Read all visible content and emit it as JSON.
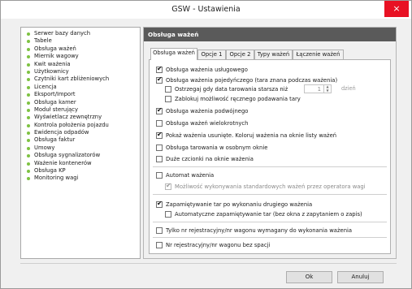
{
  "window": {
    "title": "GSW - Ustawienia",
    "close_icon": "×"
  },
  "sidebar": {
    "items": [
      "Serwer bazy danych",
      "Tabele",
      "Obsługa ważeń",
      "Miernik wagowy",
      "Kwit ważenia",
      "Użytkownicy",
      "Czytniki kart zbliżeniowych",
      "Licencja",
      "Eksport/Import",
      "Obsługa kamer",
      "Moduł sterujący",
      "Wyświetlacz zewnętrzny",
      "Kontrola położenia pojazdu",
      "Ewidencja odpadów",
      "Obsługa faktur",
      "Umowy",
      "Obsługa sygnalizatorów",
      "Ważenie kontenerów",
      "Obsługa KP",
      "Monitoring wagi"
    ],
    "dot_color": "#7ec242"
  },
  "panel": {
    "header": "Obsługa ważeń",
    "tabs": [
      "Obsługa ważeń",
      "Opcje 1",
      "Opcje 2",
      "Typy ważeń",
      "Łączenie ważeń"
    ],
    "active_tab": 0
  },
  "options": {
    "o1": {
      "label": "Obsługa ważenia usługowego",
      "checked": true
    },
    "o2": {
      "label": "Obsługa ważenia pojedyńczego (tara znana podczas ważenia)",
      "checked": true
    },
    "o3": {
      "label": "Ostrzegaj gdy data tarowania starsza niż",
      "checked": false
    },
    "o4": {
      "label": "Zablokuj możliwość ręcznego podawania tary",
      "checked": false
    },
    "o5": {
      "label": "Obsługa ważenia podwójnego",
      "checked": true
    },
    "o6": {
      "label": "Obsługa ważeń wielokrotnych",
      "checked": false
    },
    "o7": {
      "label": "Pokaż ważenia usunięte. Koloruj ważenia na oknie listy ważeń",
      "checked": true
    },
    "o8": {
      "label": "Obsługa tarowania w osobnym oknie",
      "checked": false
    },
    "o9": {
      "label": "Duże czcionki na oknie ważenia",
      "checked": false
    },
    "o10": {
      "label": "Automat ważenia",
      "checked": false
    },
    "o11": {
      "label": "Możliwość wykonywania standardowych ważeń przez operatora wagi",
      "checked": true,
      "disabled": true
    },
    "o12": {
      "label": "Zapamiętywanie tar po wykonaniu drugiego ważenia",
      "checked": true
    },
    "o13": {
      "label": "Automatyczne zapamiętywanie tar (bez okna z zapytaniem o zapis)",
      "checked": false
    },
    "o14": {
      "label": "Tylko nr rejestracyjny/nr wagonu wymagany do wykonania ważenia",
      "checked": false
    },
    "o15": {
      "label": "Nr rejestracyjny/nr wagonu bez spacji",
      "checked": false
    }
  },
  "tare_days": {
    "value": "1",
    "unit": "dzień"
  },
  "buttons": {
    "ok": "Ok",
    "cancel": "Anuluj"
  }
}
